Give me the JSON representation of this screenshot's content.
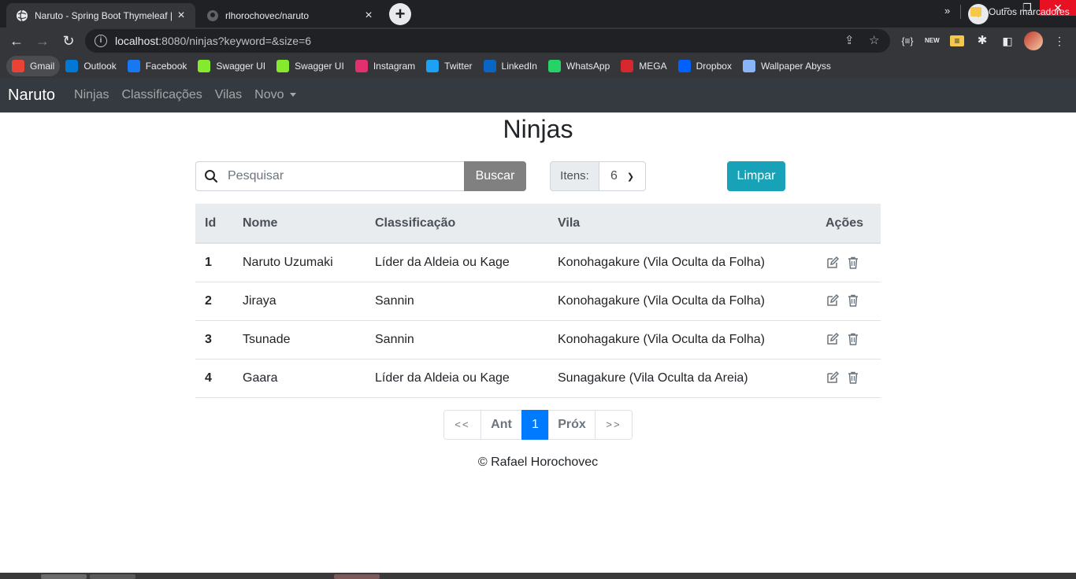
{
  "browser": {
    "tabs": [
      {
        "title": "Naruto - Spring Boot Thymeleaf | ",
        "active": true
      },
      {
        "title": "rlhorochovec/naruto",
        "active": false
      }
    ],
    "url_host": "localhost",
    "url_rest": ":8080/ninjas?keyword=&size=6",
    "bookmarks": [
      {
        "label": "Gmail",
        "icon": "gmail-icon",
        "color": "#ea4335"
      },
      {
        "label": "Outlook",
        "icon": "outlook-icon",
        "color": "#0078d4"
      },
      {
        "label": "Facebook",
        "icon": "facebook-icon",
        "color": "#1877f2"
      },
      {
        "label": "Swagger UI",
        "icon": "swagger-icon",
        "color": "#85ea2d"
      },
      {
        "label": "Swagger UI",
        "icon": "swagger-icon",
        "color": "#85ea2d"
      },
      {
        "label": "Instagram",
        "icon": "instagram-icon",
        "color": "#e1306c"
      },
      {
        "label": "Twitter",
        "icon": "twitter-icon",
        "color": "#1da1f2"
      },
      {
        "label": "LinkedIn",
        "icon": "linkedin-icon",
        "color": "#0a66c2"
      },
      {
        "label": "WhatsApp",
        "icon": "whatsapp-icon",
        "color": "#25d366"
      },
      {
        "label": "MEGA",
        "icon": "mega-icon",
        "color": "#d9272e"
      },
      {
        "label": "Dropbox",
        "icon": "dropbox-icon",
        "color": "#0061ff"
      },
      {
        "label": "Wallpaper Abyss",
        "icon": "wallpaper-abyss-icon",
        "color": "#8ab4f8"
      }
    ],
    "bookmarks_more": "»",
    "other_bookmarks": "Outros marcadores"
  },
  "navbar": {
    "brand": "Naruto",
    "links": [
      "Ninjas",
      "Classificações",
      "Vilas"
    ],
    "dropdown": "Novo"
  },
  "page": {
    "title": "Ninjas",
    "search_placeholder": "Pesquisar",
    "search_button": "Buscar",
    "items_label": "Itens:",
    "items_value": "6",
    "clear_button": "Limpar"
  },
  "table": {
    "headers": [
      "Id",
      "Nome",
      "Classificação",
      "Vila",
      "Ações"
    ],
    "rows": [
      {
        "id": "1",
        "nome": "Naruto Uzumaki",
        "classificacao": "Líder da Aldeia ou Kage",
        "vila": "Konohagakure (Vila Oculta da Folha)"
      },
      {
        "id": "2",
        "nome": "Jiraya",
        "classificacao": "Sannin",
        "vila": "Konohagakure (Vila Oculta da Folha)"
      },
      {
        "id": "3",
        "nome": "Tsunade",
        "classificacao": "Sannin",
        "vila": "Konohagakure (Vila Oculta da Folha)"
      },
      {
        "id": "4",
        "nome": "Gaara",
        "classificacao": "Líder da Aldeia ou Kage",
        "vila": "Sunagakure (Vila Oculta da Areia)"
      }
    ]
  },
  "pagination": {
    "first": "<<",
    "prev": "Ant",
    "current": "1",
    "next": "Próx",
    "last": ">>"
  },
  "footer": "© Rafael Horochovec",
  "colors": {
    "navbar_bg": "#343a40",
    "search_button": "#808080",
    "clear_button": "#17a2b8",
    "pager_active": "#007bff"
  }
}
